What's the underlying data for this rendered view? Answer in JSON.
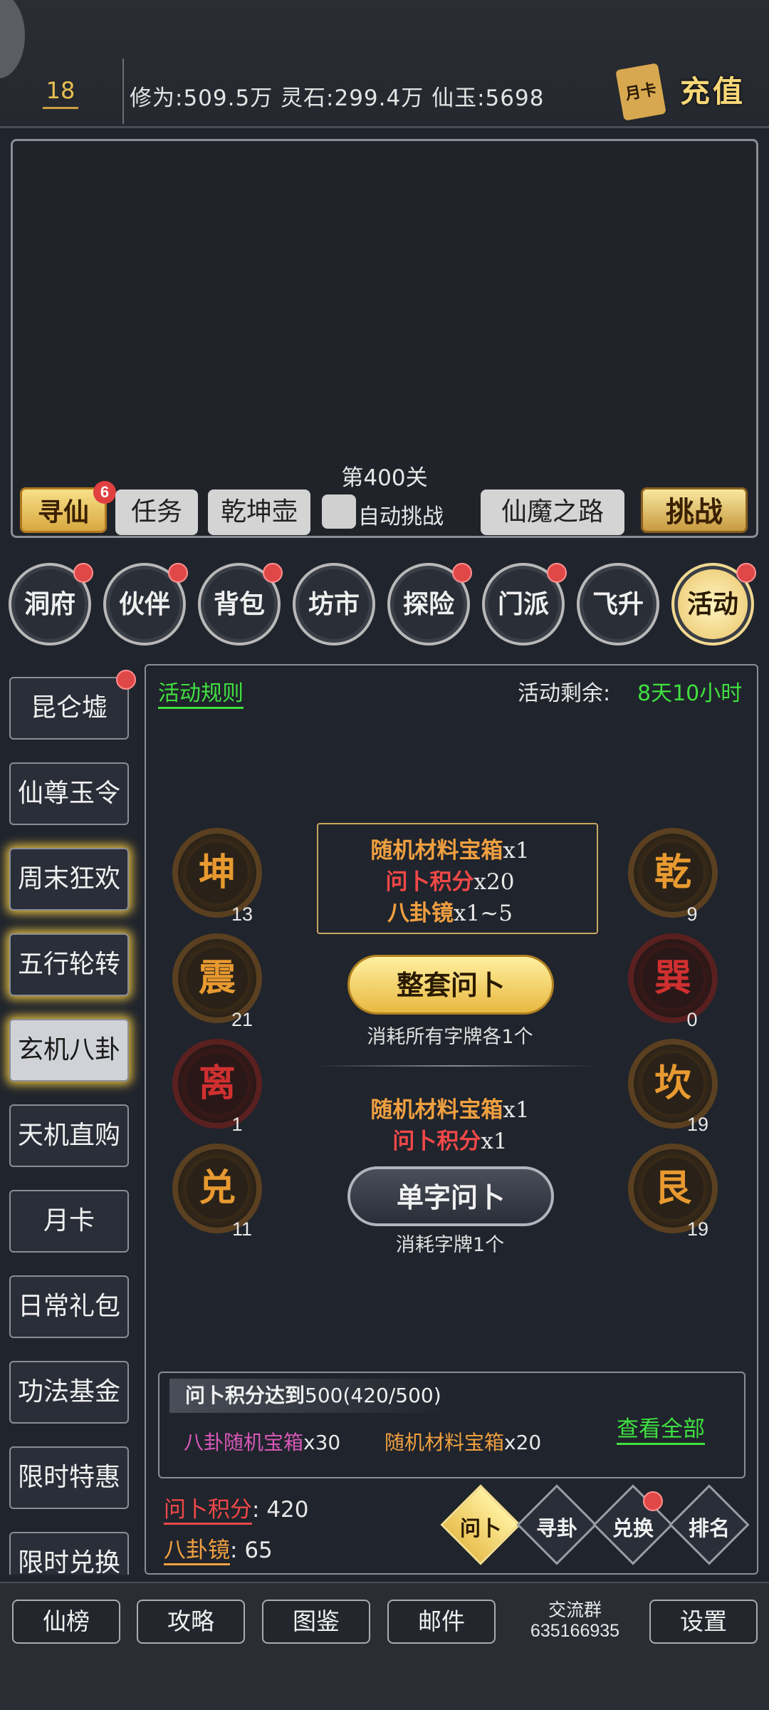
{
  "top": {
    "level": "18",
    "resources": "修为:509.5万 灵石:299.4万  仙玉:5698",
    "recharge_card": "月卡",
    "recharge": "充值"
  },
  "stage": "第400关",
  "actions": {
    "seek": "寻仙",
    "seek_badge": "6",
    "task": "任务",
    "pot": "乾坤壶",
    "auto": "自动挑战",
    "road": "仙魔之路",
    "challenge": "挑战"
  },
  "menu": [
    "洞府",
    "伙伴",
    "背包",
    "坊市",
    "探险",
    "门派",
    "飞升",
    "活动"
  ],
  "sidebar": [
    "昆仑墟",
    "仙尊玉令",
    "周末狂欢",
    "五行轮转",
    "玄机八卦",
    "天机直购",
    "月卡",
    "日常礼包",
    "功法基金",
    "限时特惠",
    "限时兑换"
  ],
  "activity": {
    "rules": "活动规则",
    "remain_label": "活动剩余:",
    "remain_value": "8天10小时",
    "trigrams": [
      {
        "ch": "坤",
        "n": "13"
      },
      {
        "ch": "震",
        "n": "21"
      },
      {
        "ch": "离",
        "n": "1"
      },
      {
        "ch": "兑",
        "n": "11"
      },
      {
        "ch": "乾",
        "n": "9"
      },
      {
        "ch": "巽",
        "n": "0"
      },
      {
        "ch": "坎",
        "n": "19"
      },
      {
        "ch": "艮",
        "n": "19"
      }
    ],
    "reward1": {
      "a": "随机材料宝箱",
      "a_q": "x1",
      "b": "问卜积分",
      "b_q": "x20",
      "c": "八卦镜",
      "c_q": "x1~5"
    },
    "full_btn": "整套问卜",
    "full_note": "消耗所有字牌各1个",
    "reward2": {
      "a": "随机材料宝箱",
      "a_q": "x1",
      "b": "问卜积分",
      "b_q": "x1"
    },
    "single_btn": "单字问卜",
    "single_note": "消耗字牌1个",
    "goal": {
      "title_label": "问卜积分达到",
      "title_value": "500(420/500)",
      "item1": "八卦随机宝箱",
      "item1_q": "x30",
      "item2": "随机材料宝箱",
      "item2_q": "x20",
      "view_all": "查看全部"
    },
    "points_label": "问卜积分",
    "points_value": "420",
    "mirror_label": "八卦镜",
    "mirror_value": "65",
    "tabs": [
      "问卜",
      "寻卦",
      "兑换",
      "排名"
    ]
  },
  "bottom": {
    "b1": "仙榜",
    "b2": "攻略",
    "b3": "图鉴",
    "b4": "邮件",
    "group_label": "交流群",
    "group_no": "635166935",
    "settings": "设置"
  }
}
